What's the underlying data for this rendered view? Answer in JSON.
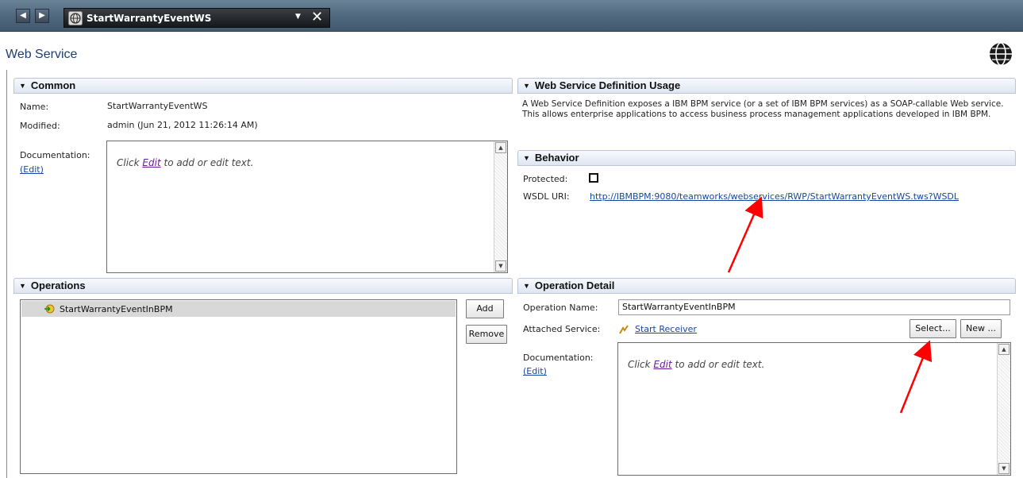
{
  "tab": {
    "title": "StartWarrantyEventWS",
    "dropdown_glyph": "▼",
    "close_glyph": "✕"
  },
  "nav": {
    "back_glyph": "◀",
    "forward_glyph": "▶"
  },
  "page": {
    "title": "Web Service"
  },
  "common": {
    "header": "Common",
    "name_label": "Name:",
    "name_value": "StartWarrantyEventWS",
    "modified_label": "Modified:",
    "modified_value": "admin (Jun 21, 2012 11:26:14 AM)",
    "documentation_label": "Documentation:",
    "edit_link": "(Edit)",
    "placeholder_pre": "Click ",
    "placeholder_link": "Edit",
    "placeholder_post": " to add or edit text."
  },
  "usage": {
    "header": "Web Service Definition Usage",
    "text": "A Web Service Definition exposes a IBM BPM service (or a set of IBM BPM services) as a SOAP-callable Web service. This allows enterprise applications to access business process management applications developed in IBM BPM."
  },
  "behavior": {
    "header": "Behavior",
    "protected_label": "Protected:",
    "protected_checked": false,
    "wsdl_label": "WSDL URI:",
    "wsdl_value": "http://IBMBPM:9080/teamworks/webservices/RWP/StartWarrantyEventWS.tws?WSDL"
  },
  "operations": {
    "header": "Operations",
    "items": [
      {
        "label": "StartWarrantyEventInBPM"
      }
    ],
    "add_label": "Add",
    "remove_label": "Remove"
  },
  "operation_detail": {
    "header": "Operation Detail",
    "name_label": "Operation Name:",
    "name_value": "StartWarrantyEventInBPM",
    "attached_label": "Attached Service:",
    "attached_value": "Start Receiver",
    "select_label": "Select...",
    "new_label": "New ...",
    "documentation_label": "Documentation:",
    "edit_link": "(Edit)",
    "placeholder_pre": "Click ",
    "placeholder_link": "Edit",
    "placeholder_post": " to add or edit text."
  },
  "colors": {
    "annotation_arrow": "#ff0000",
    "link": "#15479e",
    "header_bg": "#dfe6f1"
  },
  "icons": {
    "tab": "globe-icon",
    "page": "globe-icon",
    "operation": "operation-icon",
    "service": "service-icon"
  }
}
